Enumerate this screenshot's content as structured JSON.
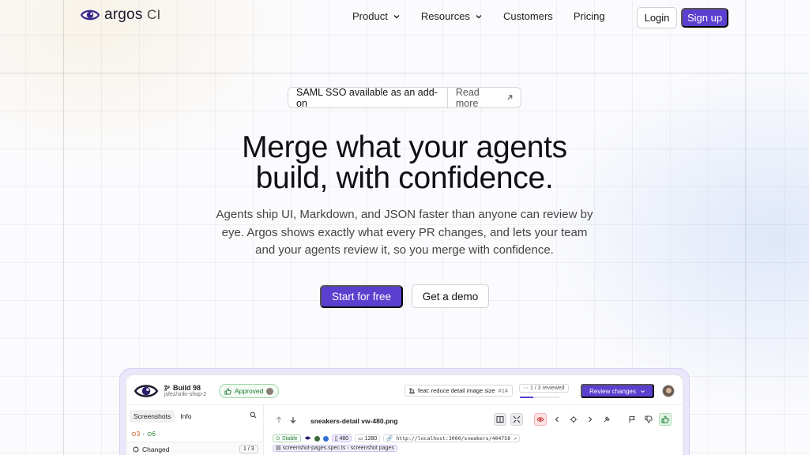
{
  "nav": {
    "logo_text": "argos",
    "logo_suffix": "CI",
    "links": [
      {
        "label": "Product",
        "dropdown": true
      },
      {
        "label": "Resources",
        "dropdown": true
      },
      {
        "label": "Customers",
        "dropdown": false
      },
      {
        "label": "Pricing",
        "dropdown": false
      }
    ],
    "login_label": "Login",
    "signup_label": "Sign up"
  },
  "announcement": {
    "text": "SAML SSO available as an add-on",
    "link_label": "Read more"
  },
  "hero": {
    "title_line1": "Merge what your agents",
    "title_line2": "build, with confidence.",
    "subtitle": "Agents ship UI, Markdown, and JSON faster than anyone can review by eye. Argos shows exactly what every PR changes, and lets your team and your agents review it, so you merge with confidence.",
    "cta_primary": "Start for free",
    "cta_secondary": "Get a demo"
  },
  "app": {
    "build_title": "Build 98",
    "build_repo": "jsfez/snkr-shop-2",
    "approved_label": "Approved",
    "pr_title": "feat: reduce detail image size",
    "pr_number": "#14",
    "reviewed_label": "1 / 3 reviewed",
    "reviewed_progress": 0.33,
    "review_button": "Review changes",
    "tabs": [
      "Screenshots",
      "Info"
    ],
    "stat_changed": "3",
    "stat_separator": "·",
    "stat_unchanged": "6",
    "group_label": "Changed",
    "group_count": "1 / 3",
    "screenshot_name": "sneakers-detail vw-480.png",
    "stable_label": "Stable",
    "width_label": "480",
    "height_label": "1280",
    "url": "http://localhost:3000/sneakers/404758",
    "file_path": "screenshot-pages.spec.ts › screenshot pages"
  },
  "colors": {
    "brand": "#5b3fcf",
    "success": "#1f7a34",
    "warning": "#c9581a",
    "danger": "#c23a3a"
  }
}
